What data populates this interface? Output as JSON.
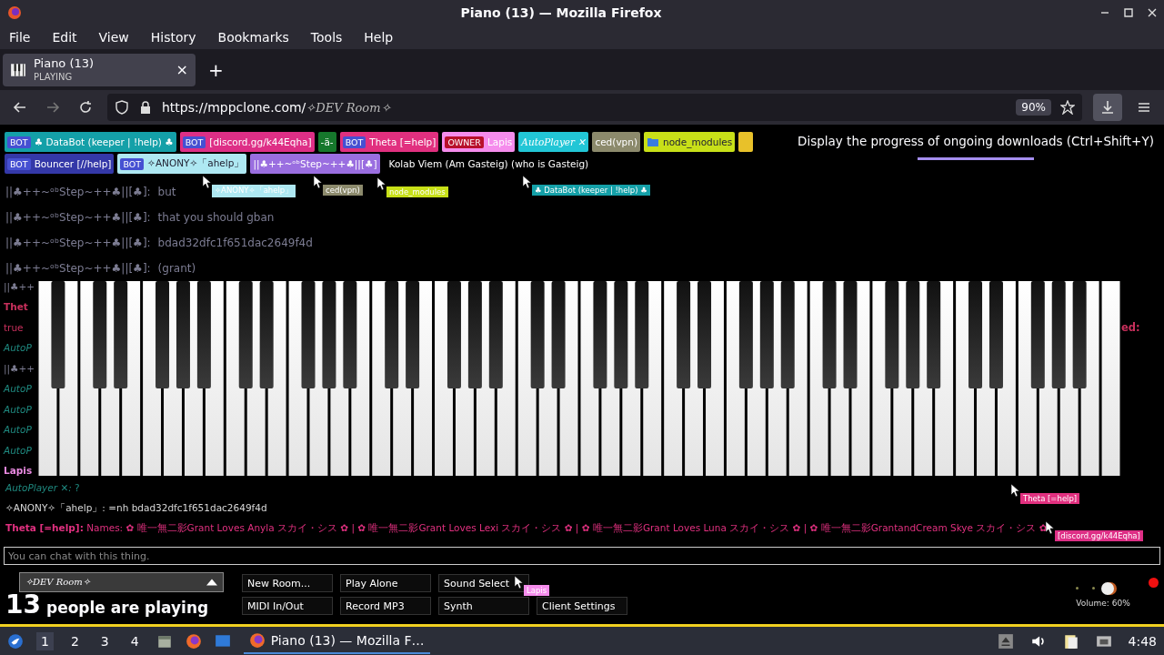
{
  "window": {
    "title": "Piano (13) — Mozilla Firefox"
  },
  "menu": [
    "File",
    "Edit",
    "View",
    "History",
    "Bookmarks",
    "Tools",
    "Help"
  ],
  "tabs": [
    {
      "title": "Piano (13)",
      "subtitle": "PLAYING",
      "selected": true,
      "close": "×"
    }
  ],
  "new_tab": "+",
  "address_bar": {
    "url": "https://mppclone.com/",
    "room": "✧DEV Room✧",
    "zoom": "90%"
  },
  "tooltip": "Display the progress of ongoing downloads (Ctrl+Shift+Y)",
  "download_progress": {
    "level": 1
  },
  "users_row_1": [
    {
      "kind": "badge",
      "tag": "BOT",
      "name": "♣ DataBot (keeper | !help) ♣",
      "color": "#14a0a8"
    },
    {
      "kind": "badge",
      "tag": "BOT",
      "name": "[discord.gg/k44Eqha]",
      "color": "#de2f86"
    },
    {
      "kind": "badge",
      "name": "-ä-",
      "color": "#16782c"
    },
    {
      "kind": "badge",
      "tag": "BOT",
      "name": "Theta [=help]",
      "color": "#e1307f"
    },
    {
      "kind": "badge",
      "tag": "OWNER",
      "name": "Lapis",
      "color": "#f58cec"
    },
    {
      "kind": "italic",
      "name": "AutoPlayer ✕",
      "color": "#22c6d6"
    },
    {
      "kind": "badge",
      "name": "ced(vpn)",
      "color": "#8c8a6c"
    },
    {
      "kind": "folder",
      "name": "node_modules",
      "color": "#c8e018"
    }
  ],
  "users_row_2": [
    {
      "kind": "badge",
      "tag": "BOT",
      "name": "Bouncer [//help]",
      "color": "#3438a8"
    },
    {
      "kind": "light",
      "tag": "BOT",
      "name": "✧ANONY✧「ahelp」",
      "color": "#aee8f2"
    },
    {
      "kind": "badge",
      "name": "||♣++~ᵒᵇStep~++♣||[♣]",
      "color": "#9a6ee0"
    },
    {
      "kind": "plain",
      "name": "Kolab Viem (Am Gasteig) (who is Gasteig)"
    }
  ],
  "chat_upper": [
    {
      "name": "||♣++~ᵒᵇStep~++♣||[♣]:",
      "text": "but",
      "color": "#7c7c92"
    },
    {
      "name": "||♣++~ᵒᵇStep~++♣||[♣]:",
      "text": "that you should gban",
      "color": "#7c7c92"
    },
    {
      "name": "||♣++~ᵒᵇStep~++♣||[♣]:",
      "text": "bdad32dfc1f651dac2649f4d",
      "color": "#7c7c92"
    },
    {
      "name": "||♣++~ᵒᵇStep~++♣||[♣]:",
      "text": "(grant)",
      "color": "#7c7c92"
    }
  ],
  "chat_behind_piano": [
    {
      "kind": "plain",
      "text": "||♣++",
      "color": "#7c7c92"
    },
    {
      "kind": "bold",
      "text": "Thet",
      "color": "#c8305c"
    },
    {
      "kind": "plain",
      "text": "true",
      "color": "#c8305c"
    },
    {
      "kind": "italic",
      "text": "AutoP",
      "color": "#1f8a80"
    },
    {
      "kind": "plain",
      "text": "||♣++",
      "color": "#7c7c92"
    },
    {
      "kind": "italic",
      "text": "AutoP",
      "color": "#1f8a80"
    },
    {
      "kind": "italic",
      "text": "AutoP",
      "color": "#1f8a80"
    },
    {
      "kind": "italic",
      "text": "AutoP",
      "color": "#1f8a80"
    },
    {
      "kind": "italic",
      "text": "AutoP",
      "color": "#1f8a80"
    },
    {
      "kind": "bold",
      "text": "Lapis",
      "color": "#e88ae0"
    }
  ],
  "chat_right_fragment": "ed:",
  "chat_lower": [
    {
      "kind": "italic",
      "name": "AutoPlayer ✕:",
      "text": "?",
      "color": "#1f8a80"
    },
    {
      "kind": "plain",
      "name": "✧ANONY✧「ahelp」:",
      "text": "=nh bdad32dfc1f651dac2649f4d",
      "color": "#d8d8d8"
    },
    {
      "kind": "bold",
      "name": "Theta [=help]:",
      "text": "Names: ✿ 唯一無二影Grant Loves Anyla スカイ・シス ✿ | ✿ 唯一無二影Grant Loves Lexi スカイ・シス ✿ | ✿ 唯一無二影Grant Loves Luna スカイ・シス ✿ | ✿ 唯一無二影GrantandCream Skye スカイ・シス ✿",
      "color": "#e0307f"
    }
  ],
  "cursors": [
    {
      "label": "✧ANONY✧「ahelp」",
      "color": "#aee8f2"
    },
    {
      "label": "ced(vpn)",
      "color": "#8c8a6c"
    },
    {
      "label": "node_modules",
      "color": "#c8e018"
    },
    {
      "label": "♣ DataBot (keeper | !help) ♣",
      "color": "#14a0a8"
    },
    {
      "label": "Theta [=help]",
      "color": "#e1307f"
    },
    {
      "label": "[discord.gg/k44Eqha]",
      "color": "#de2f86"
    },
    {
      "label": "Lapis",
      "color": "#f58cec"
    }
  ],
  "chat_input": {
    "placeholder": "You can chat with this thing."
  },
  "room_select": "✧DEV Room✧",
  "player_count": "13",
  "player_text": "people are playing",
  "buttons": [
    "New Room...",
    "Play Alone",
    "Sound Select",
    "MIDI In/Out",
    "Record MP3",
    "Synth",
    "Client Settings"
  ],
  "volume": {
    "level": 0.6,
    "label": "Volume: 60%"
  },
  "taskbar": {
    "workspaces": [
      {
        "label": "1",
        "selected": true
      },
      {
        "label": "2",
        "selected": false
      },
      {
        "label": "3",
        "selected": false
      },
      {
        "label": "4",
        "selected": false
      }
    ],
    "task": "Piano (13) — Mozilla F…",
    "clock": "4:48"
  }
}
